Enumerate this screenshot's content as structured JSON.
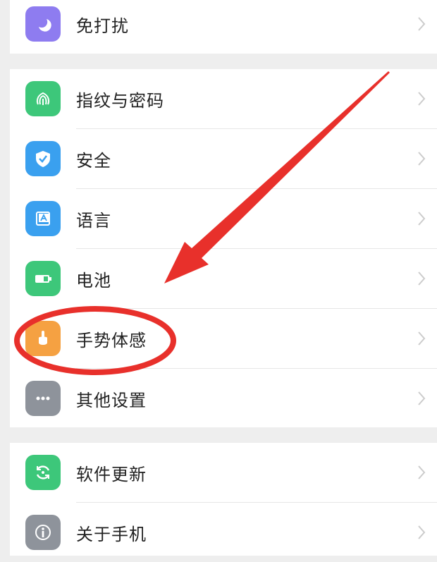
{
  "groups": [
    {
      "items": [
        {
          "label": "免打扰",
          "icon": "moon-icon",
          "color": "#8e7cf0"
        }
      ]
    },
    {
      "items": [
        {
          "label": "指纹与密码",
          "icon": "fingerprint-icon",
          "color": "#3dc77a"
        },
        {
          "label": "安全",
          "icon": "shield-check-icon",
          "color": "#3aa0ef"
        },
        {
          "label": "语言",
          "icon": "language-icon",
          "color": "#3aa0ef"
        },
        {
          "label": "电池",
          "icon": "battery-icon",
          "color": "#3dc77a"
        },
        {
          "label": "手势体感",
          "icon": "hand-gesture-icon",
          "color": "#f5a142"
        },
        {
          "label": "其他设置",
          "icon": "more-icon",
          "color": "#8e939b"
        }
      ]
    },
    {
      "items": [
        {
          "label": "软件更新",
          "icon": "update-icon",
          "color": "#3dc77a"
        },
        {
          "label": "关于手机",
          "icon": "info-icon",
          "color": "#8e939b"
        }
      ]
    }
  ],
  "annotations": {
    "arrow_color": "#e8302b",
    "circle_color": "#e8302b",
    "highlighted_item": "手势体感"
  }
}
